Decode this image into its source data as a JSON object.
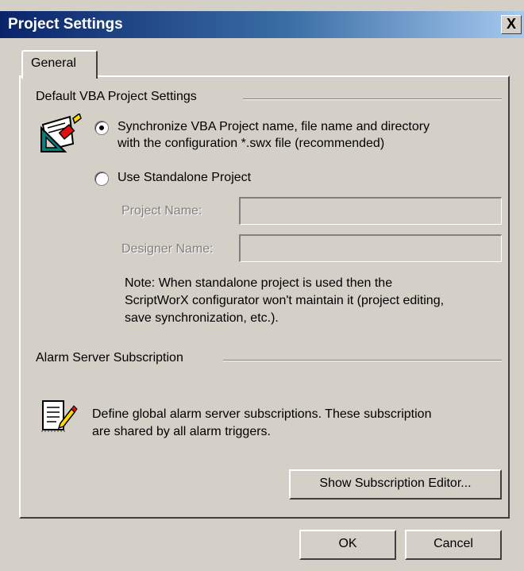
{
  "window": {
    "title": "Project Settings",
    "close_glyph": "X"
  },
  "tabs": [
    {
      "label": "General"
    }
  ],
  "vba_group": {
    "title": "Default VBA Project Settings",
    "icon": "vba-project-icon",
    "sync_option": {
      "line1": "Synchronize VBA Project name, file name and directory",
      "line2": "with the configuration *.swx file (recommended)",
      "selected": true
    },
    "standalone_option": {
      "label": "Use Standalone Project",
      "selected": false
    },
    "project_name": {
      "label": "Project Name:",
      "value": ""
    },
    "designer_name": {
      "label": "Designer Name:",
      "value": ""
    },
    "note": {
      "line1": "Note: When standalone project is used then the",
      "line2": "ScriptWorX configurator won't maintain it (project editing,",
      "line3": "save synchronization, etc.)."
    }
  },
  "alarm_group": {
    "title": "Alarm Server Subscription",
    "icon": "subscription-edit-icon",
    "description_line1": "Define global alarm server subscriptions. These subscription",
    "description_line2": "are shared by all alarm triggers.",
    "editor_button": "Show Subscription Editor..."
  },
  "buttons": {
    "ok": "OK",
    "cancel": "Cancel"
  }
}
